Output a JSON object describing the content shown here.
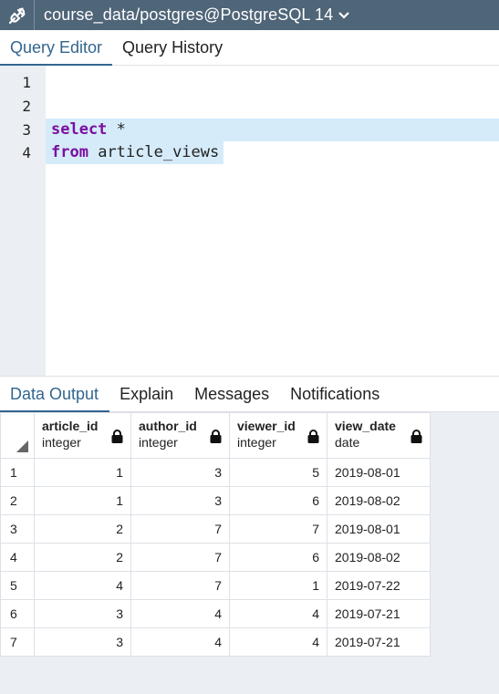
{
  "header": {
    "connection_title": "course_data/postgres@PostgreSQL 14"
  },
  "editor_tabs": [
    {
      "label": "Query Editor",
      "active": true
    },
    {
      "label": "Query History",
      "active": false
    }
  ],
  "editor": {
    "line_numbers": [
      "1",
      "2",
      "3",
      "4"
    ],
    "line3": {
      "kw": "select",
      "rest": " *"
    },
    "line4": {
      "kw": "from",
      "rest": " article_views"
    }
  },
  "output_tabs": [
    {
      "label": "Data Output",
      "active": true
    },
    {
      "label": "Explain"
    },
    {
      "label": "Messages"
    },
    {
      "label": "Notifications"
    }
  ],
  "grid": {
    "columns": [
      {
        "name": "article_id",
        "type": "integer"
      },
      {
        "name": "author_id",
        "type": "integer"
      },
      {
        "name": "viewer_id",
        "type": "integer"
      },
      {
        "name": "view_date",
        "type": "date"
      }
    ],
    "rows": [
      [
        "1",
        "1",
        "3",
        "5",
        "2019-08-01"
      ],
      [
        "2",
        "1",
        "3",
        "6",
        "2019-08-02"
      ],
      [
        "3",
        "2",
        "7",
        "7",
        "2019-08-01"
      ],
      [
        "4",
        "2",
        "7",
        "6",
        "2019-08-02"
      ],
      [
        "5",
        "4",
        "7",
        "1",
        "2019-07-22"
      ],
      [
        "6",
        "3",
        "4",
        "4",
        "2019-07-21"
      ],
      [
        "7",
        "3",
        "4",
        "4",
        "2019-07-21"
      ]
    ]
  }
}
